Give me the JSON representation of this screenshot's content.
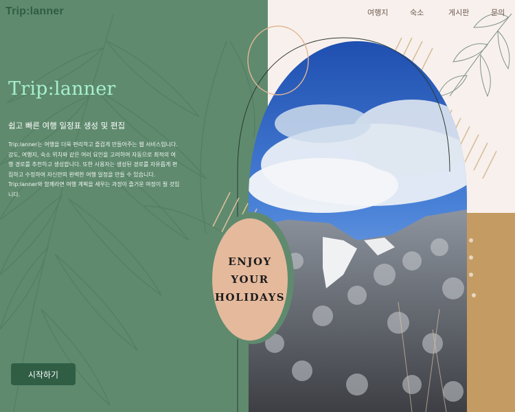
{
  "brand": {
    "logo": "Trip:lanner"
  },
  "nav": {
    "items": [
      {
        "label": "여행지"
      },
      {
        "label": "숙소"
      },
      {
        "label": "게시판"
      },
      {
        "label": "문의"
      }
    ]
  },
  "hero": {
    "title": "Trip:lanner",
    "subtitle": "쉽고 빠른 여행 일정표 생성 및 편집",
    "description": "Trip:lanner는 여행을 더욱 편리하고 즐겁게 만들어주는 웹 서비스입니다. 강도, 여행지, 숙소 위치와 같은 여러 요인을 고려하여 자동으로 최적의 여행 경로를 추천하고 생성합니다. 또한 사용자는 생성된 경로를 자유롭게 편집하고 수정하여 자신만의 완벽한 여행 일정을 만들 수 있습니다. Trip:lanner와 함께라면 여행 계획을 세우는 과정이 즐거운 여정이 될 것입니다.",
    "cta": "시작하기"
  },
  "badge": {
    "line1": "ENJOY",
    "line2": "YOUR",
    "line3": "HOLIDAYS"
  },
  "colors": {
    "green": "#5f8a6e",
    "dark_green": "#2f5e45",
    "mint": "#a7f0cf",
    "peach": "#e5b99c",
    "tan": "#c49c63",
    "cream": "#f8f0ec"
  }
}
